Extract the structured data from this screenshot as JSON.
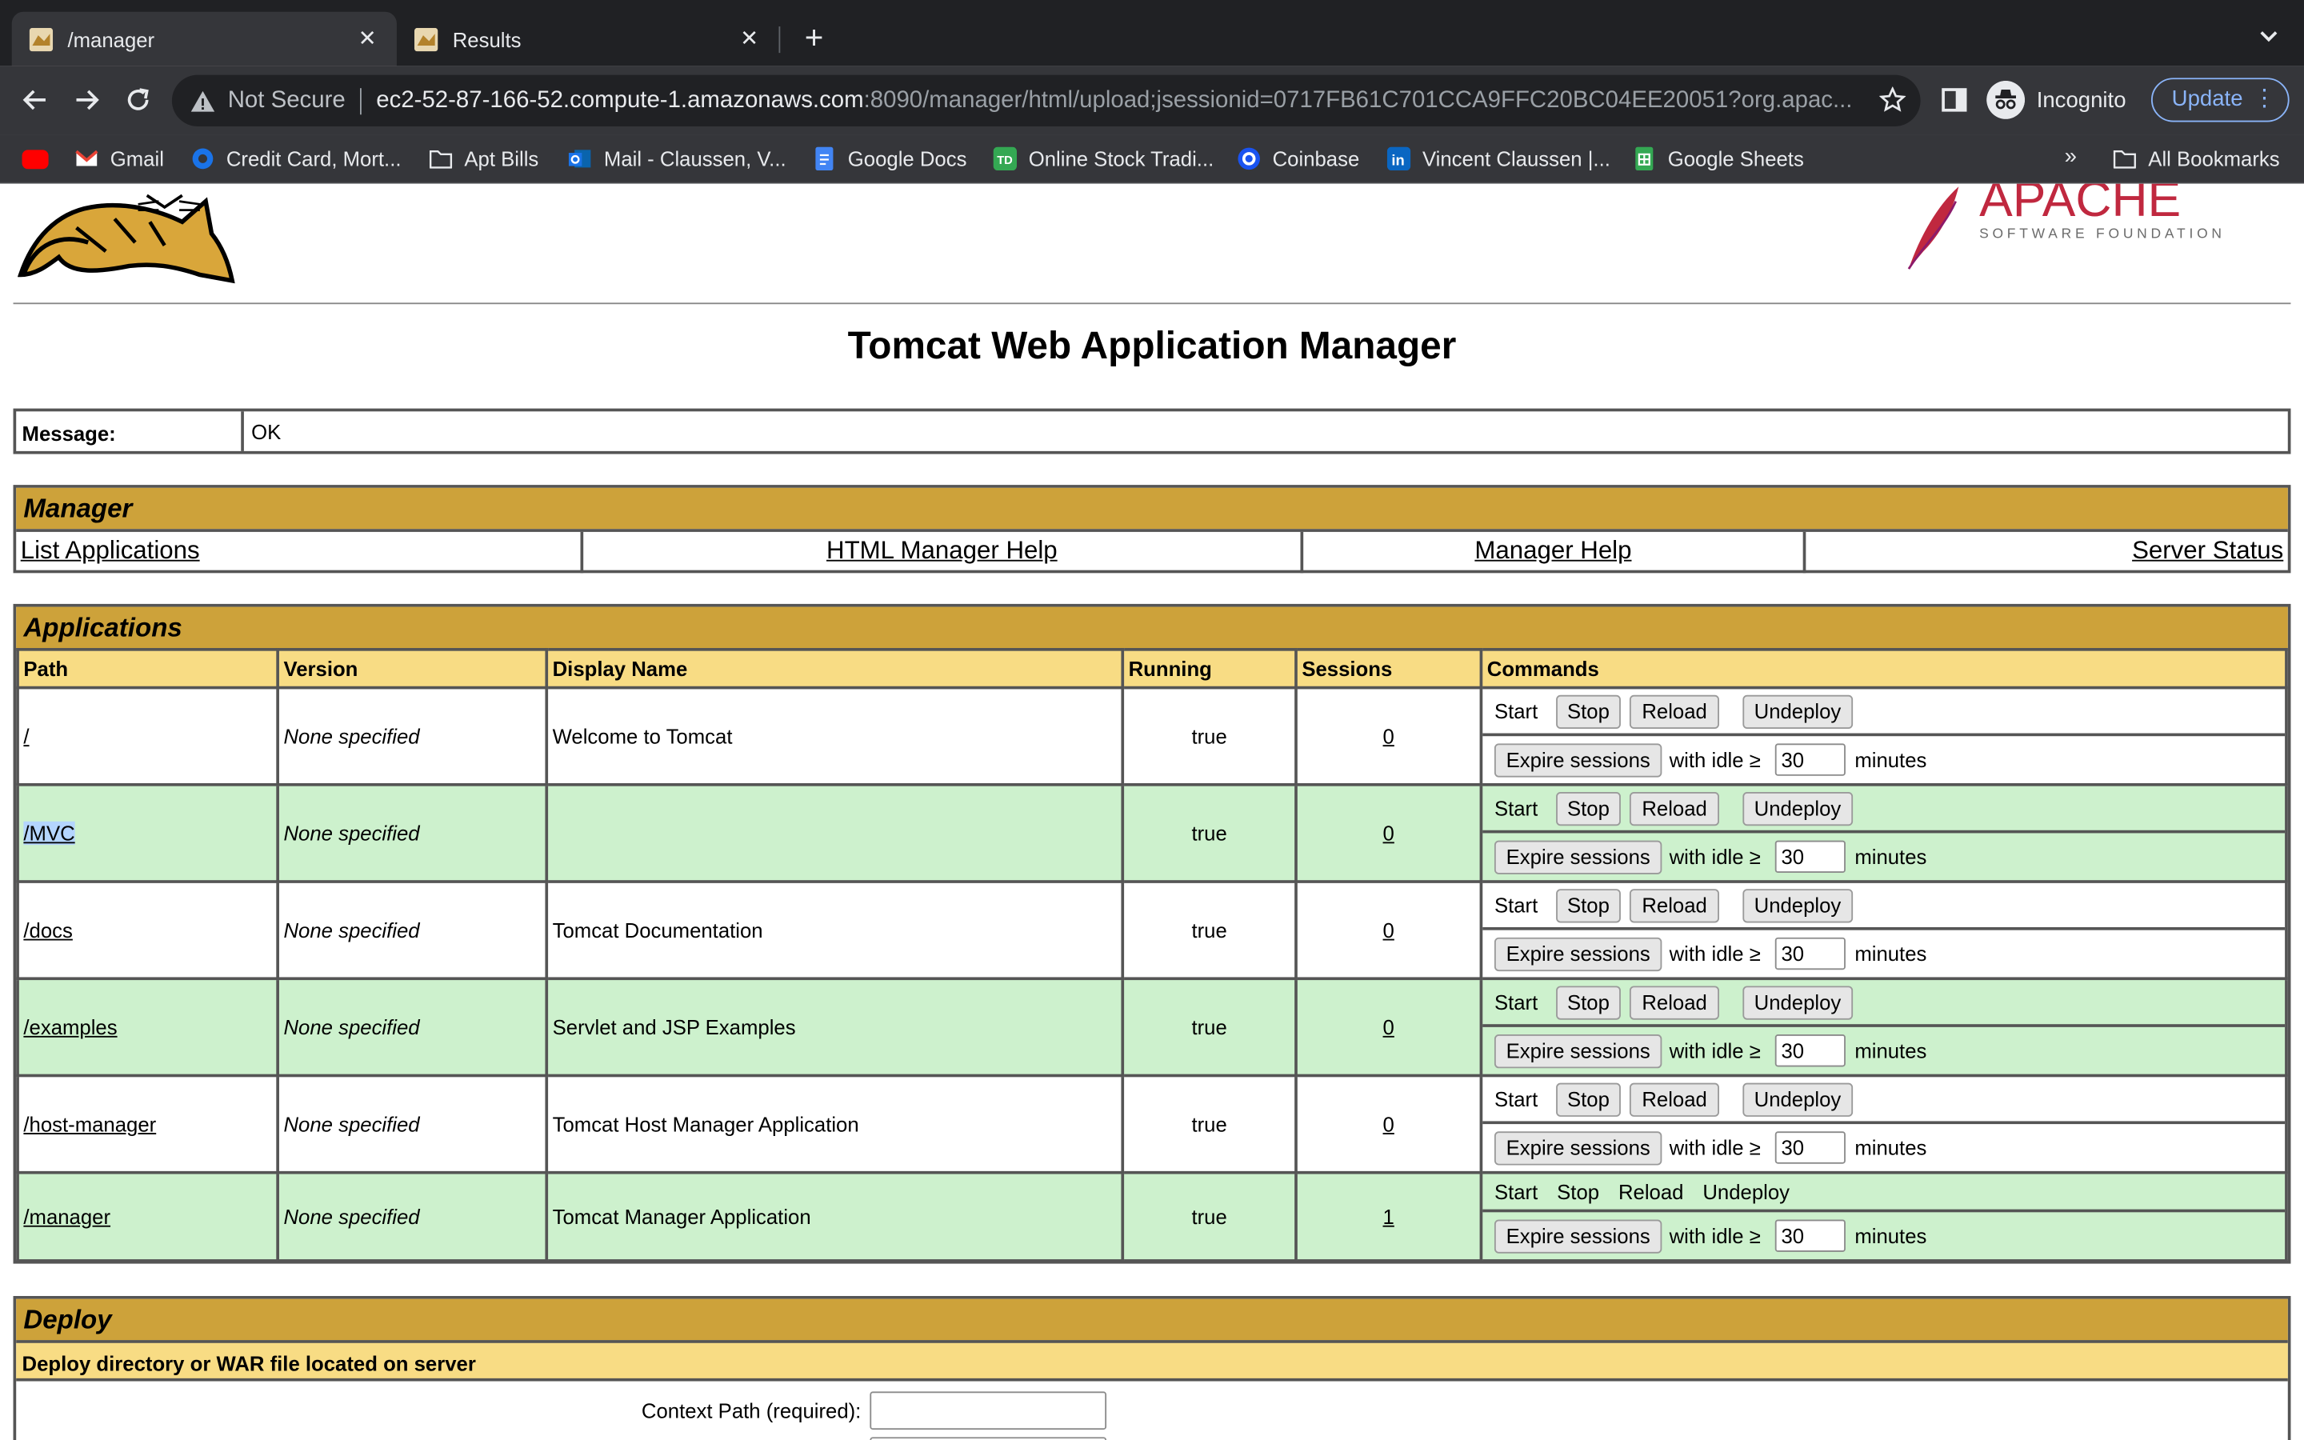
{
  "browser": {
    "tabs": [
      {
        "title": "/manager",
        "active": true
      },
      {
        "title": "Results",
        "active": false
      }
    ],
    "omnibox": {
      "security": "Not Secure",
      "host": "ec2-52-87-166-52.compute-1.amazonaws.com",
      "rest": ":8090/manager/html/upload;jsessionid=0717FB61C701CCA9FFC20BC04EE20051?org.apac..."
    },
    "profile_label": "Incognito",
    "update_label": "Update",
    "bookmarks": [
      {
        "label": "",
        "icon": "youtube-icon"
      },
      {
        "label": "Gmail",
        "icon": "gmail-icon"
      },
      {
        "label": "Credit Card, Mort...",
        "icon": "chase-icon"
      },
      {
        "label": "Apt Bills",
        "icon": "folder-icon"
      },
      {
        "label": "Mail - Claussen, V...",
        "icon": "outlook-icon"
      },
      {
        "label": "Google Docs",
        "icon": "docs-icon"
      },
      {
        "label": "Online Stock Tradi...",
        "icon": "td-icon"
      },
      {
        "label": "Coinbase",
        "icon": "coinbase-icon"
      },
      {
        "label": "Vincent Claussen |...",
        "icon": "linkedin-icon"
      },
      {
        "label": "Google Sheets",
        "icon": "sheets-icon"
      }
    ],
    "bookmarks_more": "»",
    "all_bookmarks": "All Bookmarks"
  },
  "page": {
    "title": "Tomcat Web Application Manager",
    "apache_logo_text": "APACHE",
    "apache_logo_sub": "SOFTWARE FOUNDATION",
    "message": {
      "label": "Message:",
      "value": "OK"
    },
    "manager": {
      "heading": "Manager",
      "links": [
        "List Applications",
        "HTML Manager Help",
        "Manager Help",
        "Server Status"
      ]
    },
    "applications": {
      "heading": "Applications",
      "columns": [
        "Path",
        "Version",
        "Display Name",
        "Running",
        "Sessions",
        "Commands"
      ],
      "rows": [
        {
          "path": "/",
          "version": "None specified",
          "display": "Welcome to Tomcat",
          "running": "true",
          "sessions": "0"
        },
        {
          "path": "/MVC",
          "version": "None specified",
          "display": "",
          "running": "true",
          "sessions": "0"
        },
        {
          "path": "/docs",
          "version": "None specified",
          "display": "Tomcat Documentation",
          "running": "true",
          "sessions": "0"
        },
        {
          "path": "/examples",
          "version": "None specified",
          "display": "Servlet and JSP Examples",
          "running": "true",
          "sessions": "0"
        },
        {
          "path": "/host-manager",
          "version": "None specified",
          "display": "Tomcat Host Manager Application",
          "running": "true",
          "sessions": "0"
        },
        {
          "path": "/manager",
          "version": "None specified",
          "display": "Tomcat Manager Application",
          "running": "true",
          "sessions": "1"
        }
      ],
      "commands": {
        "start": "Start",
        "stop": "Stop",
        "reload": "Reload",
        "undeploy": "Undeploy",
        "expire": "Expire sessions",
        "with_idle": "with idle ≥",
        "idle_value": "30",
        "minutes": "minutes"
      }
    },
    "deploy": {
      "heading": "Deploy",
      "subheading": "Deploy directory or WAR file located on server",
      "context_path_label": "Context Path (required):"
    }
  },
  "colors": {
    "section_header": "#cda23a",
    "column_header": "#f8dc84",
    "row_alt": "#cdf1cd"
  }
}
